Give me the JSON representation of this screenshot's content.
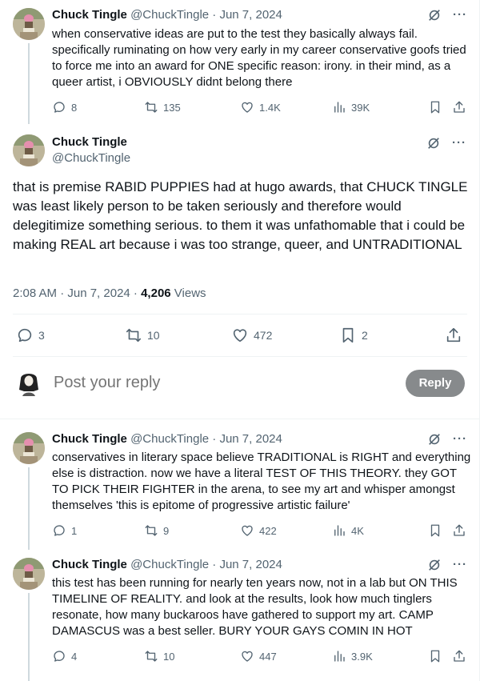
{
  "colors": {
    "text": "#0f1419",
    "muted": "#536471",
    "divider": "#eff3f4",
    "reply_button": "#878a8c"
  },
  "tweets": [
    {
      "name": "Chuck Tingle",
      "meta": "@ChuckTingle · Jun 7, 2024",
      "text": "when conservative ideas are put to the test they basically always fail. specifically ruminating on how very early in my career conservative goofs tried to force me into an award for ONE specific reason: irony. in their mind, as a queer artist, i OBVIOUSLY didnt belong there",
      "replies": "8",
      "retweets": "135",
      "likes": "1.4K",
      "views": "39K"
    },
    {
      "name": "Chuck Tingle",
      "meta": "@ChuckTingle · Jun 7, 2024",
      "text": "conservatives in literary space believe TRADITIONAL is RIGHT and everything else is distraction. now we have a literal TEST OF THIS THEORY. they GOT TO PICK THEIR FIGHTER in the arena, to see my art and whisper amongst themselves 'this is epitome of progressive artistic failure'",
      "replies": "1",
      "retweets": "9",
      "likes": "422",
      "views": "4K"
    },
    {
      "name": "Chuck Tingle",
      "meta": "@ChuckTingle · Jun 7, 2024",
      "text": "this test has been running for nearly ten years now, not in a lab but ON THIS TIMELINE OF REALITY. and look at the results, look how much tinglers resonate, how many buckaroos have gathered to support my art. CAMP DAMASCUS was a best seller. BURY YOUR GAYS COMIN IN HOT",
      "replies": "4",
      "retweets": "10",
      "likes": "447",
      "views": "3.9K"
    }
  ],
  "main": {
    "name": "Chuck Tingle",
    "handle": "@ChuckTingle",
    "text": "that is premise RABID PUPPIES had at hugo awards, that CHUCK TINGLE was least likely person to be taken seriously and therefore would delegitimize something serious. to them it was unfathomable that i could be making REAL art because i was too strange, queer, and UNTRADITIONAL",
    "time": "2:08 AM · Jun 7, 2024 · ",
    "views_count": "4,206",
    "views_label": " Views",
    "replies": "3",
    "retweets": "10",
    "likes": "472",
    "bookmarks": "2"
  },
  "compose": {
    "placeholder": "Post your reply",
    "button": "Reply"
  },
  "icons": [
    "grok-icon",
    "more-icon",
    "reply-icon",
    "retweet-icon",
    "like-icon",
    "views-icon",
    "bookmark-icon",
    "share-icon"
  ]
}
